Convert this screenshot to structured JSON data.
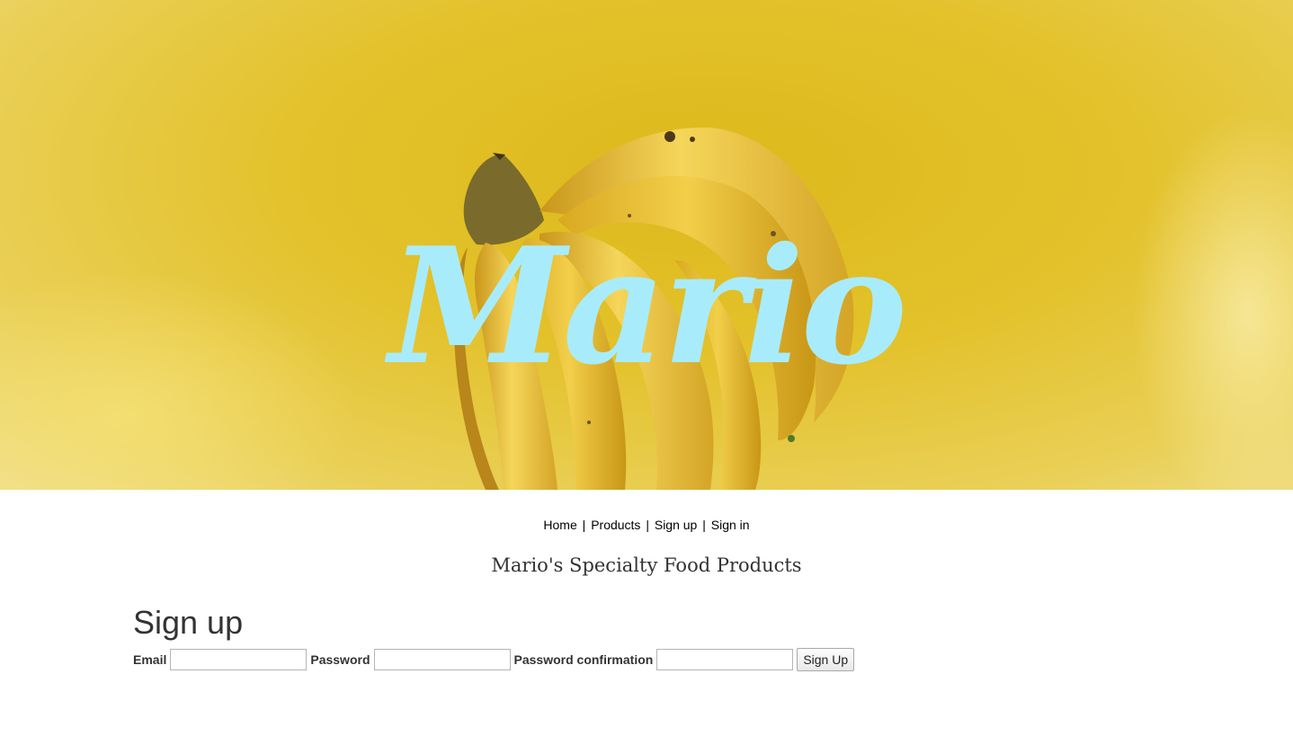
{
  "hero": {
    "logo_text": "Mario"
  },
  "nav": {
    "items": [
      "Home",
      "Products",
      "Sign up",
      "Sign in"
    ],
    "separator": "|"
  },
  "tagline": "Mario's Specialty Food Products",
  "signup": {
    "heading": "Sign up",
    "email_label": "Email",
    "email_value": "",
    "password_label": "Password",
    "password_value": "",
    "password_confirmation_label": "Password confirmation",
    "password_confirmation_value": "",
    "submit_label": "Sign Up"
  },
  "colors": {
    "hero_background": "#e3c12a",
    "logo": "#a8ecfc",
    "text": "#333333"
  }
}
